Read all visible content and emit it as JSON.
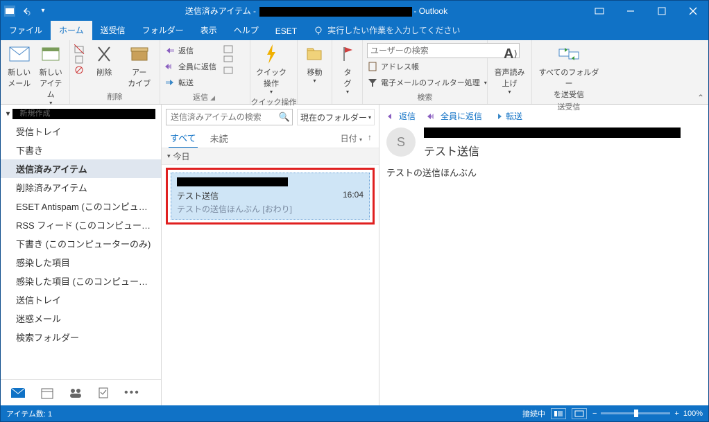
{
  "title": {
    "prefix": "送信済みアイテム - ",
    "suffix": "- Outlook"
  },
  "tabs": {
    "file": "ファイル",
    "home": "ホーム",
    "sendrecv": "送受信",
    "folder": "フォルダー",
    "view": "表示",
    "help": "ヘルプ",
    "eset": "ESET",
    "tell": "実行したい作業を入力してください"
  },
  "ribbon": {
    "new": {
      "mail": "新しい\nメール",
      "items": "新しい\nアイテム",
      "label": "新規作成"
    },
    "delete": {
      "delete": "削除",
      "archive": "アー\nカイブ",
      "label": "削除"
    },
    "respond": {
      "reply": "返信",
      "replyall": "全員に返信",
      "forward": "転送",
      "label": "返信"
    },
    "quick": {
      "action": "クイック\n操作",
      "label": "クイック操作"
    },
    "move": {
      "move": "移動",
      "label": ""
    },
    "tag": {
      "tag": "タ\nグ",
      "label": ""
    },
    "find": {
      "search_ph": "ユーザーの検索",
      "addr": "アドレス帳",
      "filter": "電子メールのフィルター処理",
      "label": "検索"
    },
    "speech": {
      "read": "音声読み\n上げ",
      "label": ""
    },
    "sendrecv": {
      "all": "すべてのフォルダー\nを送受信",
      "label": "送受信"
    }
  },
  "folders": {
    "items": [
      {
        "name": "受信トレイ",
        "sel": false
      },
      {
        "name": "下書き",
        "sel": false
      },
      {
        "name": "送信済みアイテム",
        "sel": true
      },
      {
        "name": "削除済みアイテム",
        "sel": false
      },
      {
        "name": "ESET Antispam (このコンピュータ…",
        "sel": false
      },
      {
        "name": "RSS フィード (このコンピューターのみ)",
        "sel": false
      },
      {
        "name": "下書き (このコンピューターのみ)",
        "sel": false
      },
      {
        "name": "感染した項目",
        "sel": false
      },
      {
        "name": "感染した項目 (このコンピューターのみ)",
        "sel": false
      },
      {
        "name": "送信トレイ",
        "sel": false
      },
      {
        "name": "迷惑メール",
        "sel": false
      },
      {
        "name": "検索フォルダー",
        "sel": false
      }
    ]
  },
  "list": {
    "search_ph": "送信済みアイテムの検索",
    "scope": "現在のフォルダー",
    "filter_all": "すべて",
    "filter_unread": "未読",
    "sort": "日付",
    "group_today": "今日",
    "msg": {
      "subject": "テスト送信",
      "preview": "テストの送信ほんぶん [おわり]",
      "time": "16:04"
    }
  },
  "read": {
    "reply": "返信",
    "replyall": "全員に返信",
    "forward": "転送",
    "avatar_initial": "S",
    "subject": "テスト送信",
    "body": "テストの送信ほんぶん"
  },
  "status": {
    "items": "アイテム数: 1",
    "conn": "接続中",
    "zoom": "100%"
  }
}
